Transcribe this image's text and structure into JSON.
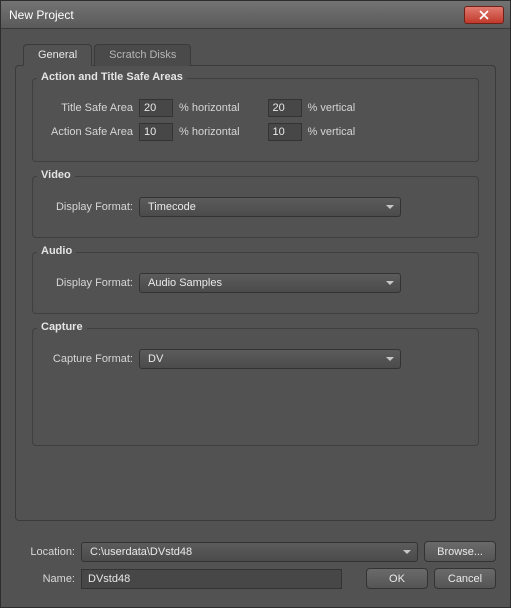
{
  "window": {
    "title": "New Project"
  },
  "tabs": {
    "general": "General",
    "scratch": "Scratch Disks"
  },
  "safe_areas": {
    "group_title": "Action and Title Safe Areas",
    "title_label": "Title Safe Area",
    "action_label": "Action Safe Area",
    "pct_horiz": "% horizontal",
    "pct_vert": "% vertical",
    "title_h": "20",
    "title_v": "20",
    "action_h": "10",
    "action_v": "10"
  },
  "video": {
    "group_title": "Video",
    "label": "Display Format:",
    "value": "Timecode"
  },
  "audio": {
    "group_title": "Audio",
    "label": "Display Format:",
    "value": "Audio Samples"
  },
  "capture": {
    "group_title": "Capture",
    "label": "Capture Format:",
    "value": "DV"
  },
  "footer": {
    "location_label": "Location:",
    "location_value": "C:\\userdata\\DVstd48",
    "browse": "Browse...",
    "name_label": "Name:",
    "name_value": "DVstd48",
    "ok": "OK",
    "cancel": "Cancel"
  }
}
